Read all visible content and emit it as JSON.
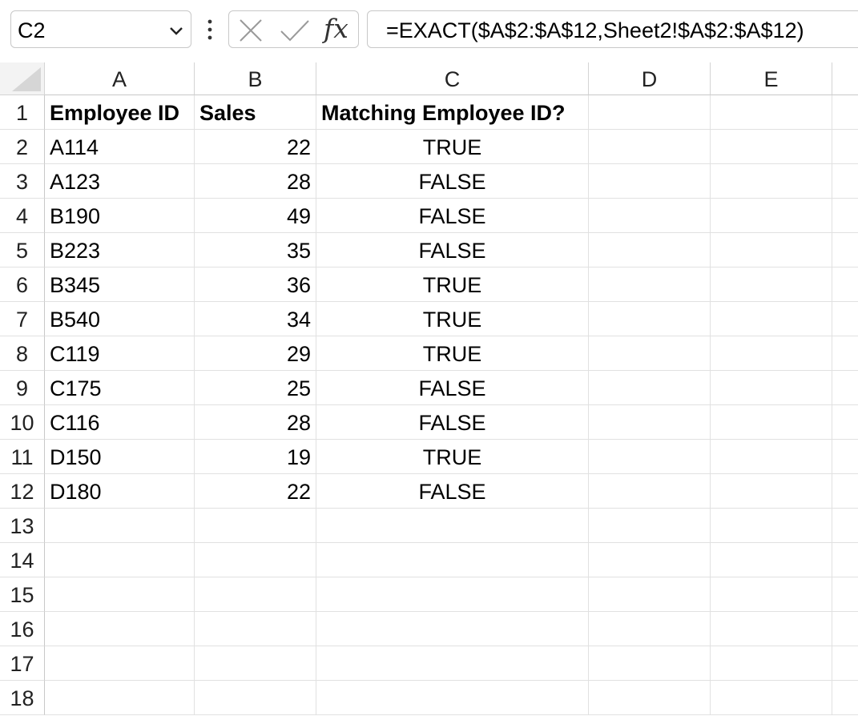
{
  "formula_bar": {
    "name_box": "C2",
    "formula": "=EXACT($A$2:$A$12,Sheet2!$A$2:$A$12)",
    "fx_label": "fx"
  },
  "columns": [
    "A",
    "B",
    "C",
    "D",
    "E"
  ],
  "rows": [
    "1",
    "2",
    "3",
    "4",
    "5",
    "6",
    "7",
    "8",
    "9",
    "10",
    "11",
    "12",
    "13",
    "14",
    "15",
    "16",
    "17",
    "18"
  ],
  "headers": {
    "employee_id": "Employee ID",
    "sales": "Sales",
    "matching": "Matching Employee ID?"
  },
  "data": [
    {
      "id": "A114",
      "sales": "22",
      "match": "TRUE"
    },
    {
      "id": "A123",
      "sales": "28",
      "match": "FALSE"
    },
    {
      "id": "B190",
      "sales": "49",
      "match": "FALSE"
    },
    {
      "id": "B223",
      "sales": "35",
      "match": "FALSE"
    },
    {
      "id": "B345",
      "sales": "36",
      "match": "TRUE"
    },
    {
      "id": "B540",
      "sales": "34",
      "match": "TRUE"
    },
    {
      "id": "C119",
      "sales": "29",
      "match": "TRUE"
    },
    {
      "id": "C175",
      "sales": "25",
      "match": "FALSE"
    },
    {
      "id": "C116",
      "sales": "28",
      "match": "FALSE"
    },
    {
      "id": "D150",
      "sales": "19",
      "match": "TRUE"
    },
    {
      "id": "D180",
      "sales": "22",
      "match": "FALSE"
    }
  ]
}
